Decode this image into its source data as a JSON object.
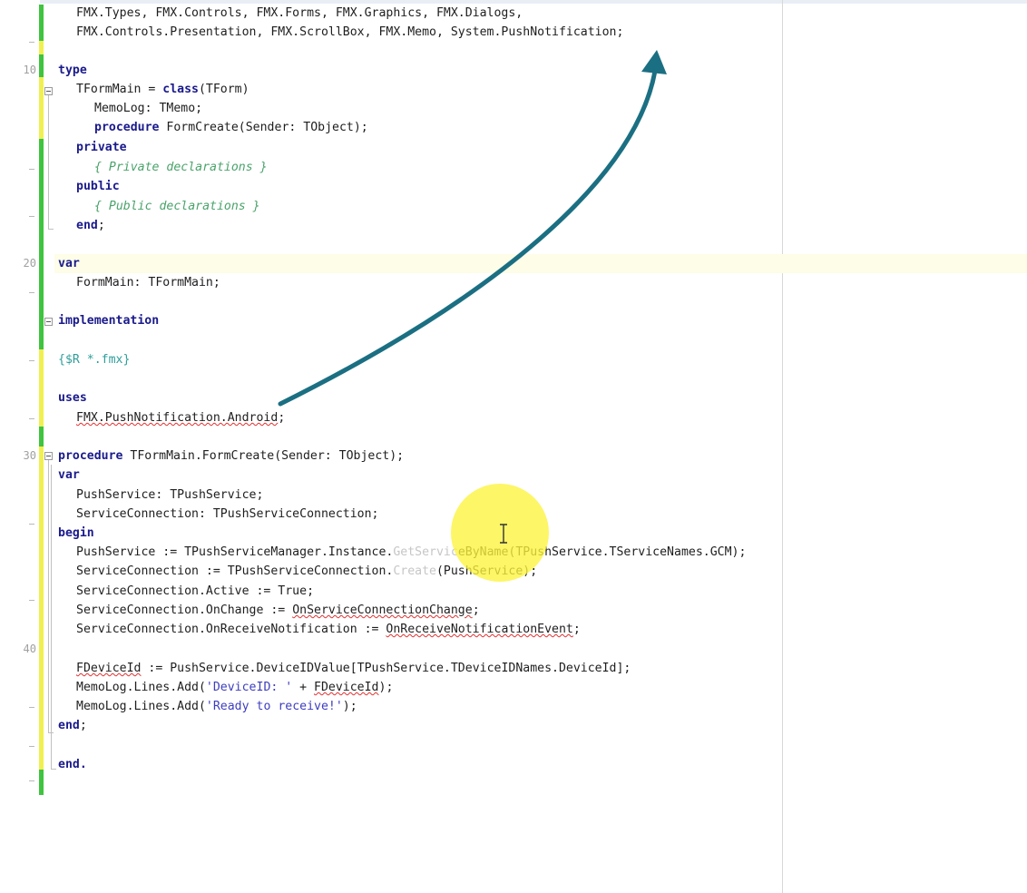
{
  "editor": {
    "line_numbers": [
      "10",
      "20",
      "30",
      "40"
    ],
    "code": {
      "uses_units_1": "FMX.Types, FMX.Controls, FMX.Forms, FMX.Graphics, FMX.Dialogs,",
      "uses_units_2": "FMX.Controls.Presentation, FMX.ScrollBox, FMX.Memo, System.PushNotification;",
      "kw_type": "type",
      "class_decl_name": "TFormMain = ",
      "kw_class": "class",
      "class_decl_parent": "(TForm)",
      "field_memolog": "MemoLog: TMemo;",
      "kw_procedure": "procedure",
      "method_formcreate_decl": " FormCreate(Sender: TObject);",
      "kw_private": "private",
      "comment_private": "{ Private declarations }",
      "kw_public": "public",
      "comment_public": "{ Public declarations }",
      "kw_end": "end",
      "semicolon": ";",
      "kw_var": "var",
      "var_formmain": "FormMain: TFormMain;",
      "kw_implementation": "implementation",
      "directive_resource": "{$R *.fmx}",
      "kw_uses": "uses",
      "android_unit": "FMX.PushNotification.Android",
      "proc_impl_signature": " TFormMain.FormCreate(Sender: TObject);",
      "local_pushservice": "PushService: TPushService;",
      "local_serviceconnection": "ServiceConnection: TPushServiceConnection;",
      "kw_begin": "begin",
      "stmt_getservice_a": "PushService := TPushServiceManager.Instance.",
      "stmt_getservice_faded": "GetServic",
      "stmt_getservice_b": "eByName(TPushService.TServiceNames.GCM);",
      "stmt_create_a": "ServiceConnection := TPushServiceConnection.",
      "stmt_create_faded": "Create",
      "stmt_create_b": "(PushService);",
      "stmt_active": "ServiceConnection.Active := True;",
      "stmt_onchange_a": "ServiceConnection.OnChange := ",
      "stmt_onchange_handler": "OnServiceConnectionChange",
      "stmt_onreceive_a": "ServiceConnection.OnReceiveNotification := ",
      "stmt_onreceive_handler": "OnReceiveNotificationEvent",
      "fdeviceid": "FDeviceId",
      "stmt_deviceid_rest": " := PushService.DeviceIDValue[TPushService.TDeviceIDNames.DeviceId];",
      "stmt_memolog_add_a": "MemoLog.Lines.Add(",
      "str_deviceid": "'DeviceID: '",
      "stmt_memolog_add_plus": " + ",
      "stmt_memolog_add_close": ");",
      "str_ready": "'Ready to receive!'",
      "kw_end_dot": "end."
    }
  },
  "colors": {
    "keyword": "#1a1a8c",
    "comment": "#4aa36b",
    "directive": "#2e9e9a",
    "string": "#3d3dc0",
    "change_saved": "#3ec43e",
    "change_unsaved": "#f0f050",
    "arrow": "#1b6f82",
    "cursor_highlight": "#fcf33c"
  },
  "icons": {
    "fold": "fold-minus-icon",
    "cursor": "text-cursor-icon",
    "annotation": "curved-arrow-icon"
  }
}
